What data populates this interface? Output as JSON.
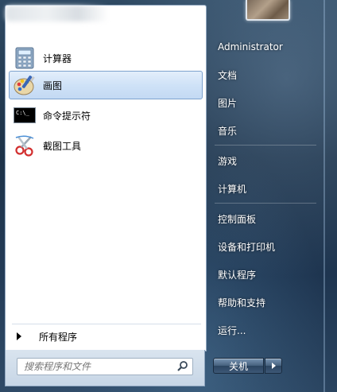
{
  "programs": [
    {
      "label": "计算器",
      "icon": "calculator-icon"
    },
    {
      "label": "画图",
      "icon": "paint-icon",
      "selected": true
    },
    {
      "label": "命令提示符",
      "icon": "command-prompt-icon",
      "icon_text": "C:\\_"
    },
    {
      "label": "截图工具",
      "icon": "snipping-tool-icon"
    }
  ],
  "all_programs_label": "所有程序",
  "search": {
    "placeholder": "搜索程序和文件",
    "value": ""
  },
  "right_menu": {
    "user": "Administrator",
    "items": [
      "文档",
      "图片",
      "音乐",
      "游戏",
      "计算机",
      "控制面板",
      "设备和打印机",
      "默认程序",
      "帮助和支持",
      "运行..."
    ]
  },
  "shutdown_label": "关机",
  "colors": {
    "selected_bg": "#cfe2f7",
    "selected_border": "#7da2ce",
    "panel": "#ffffff"
  }
}
